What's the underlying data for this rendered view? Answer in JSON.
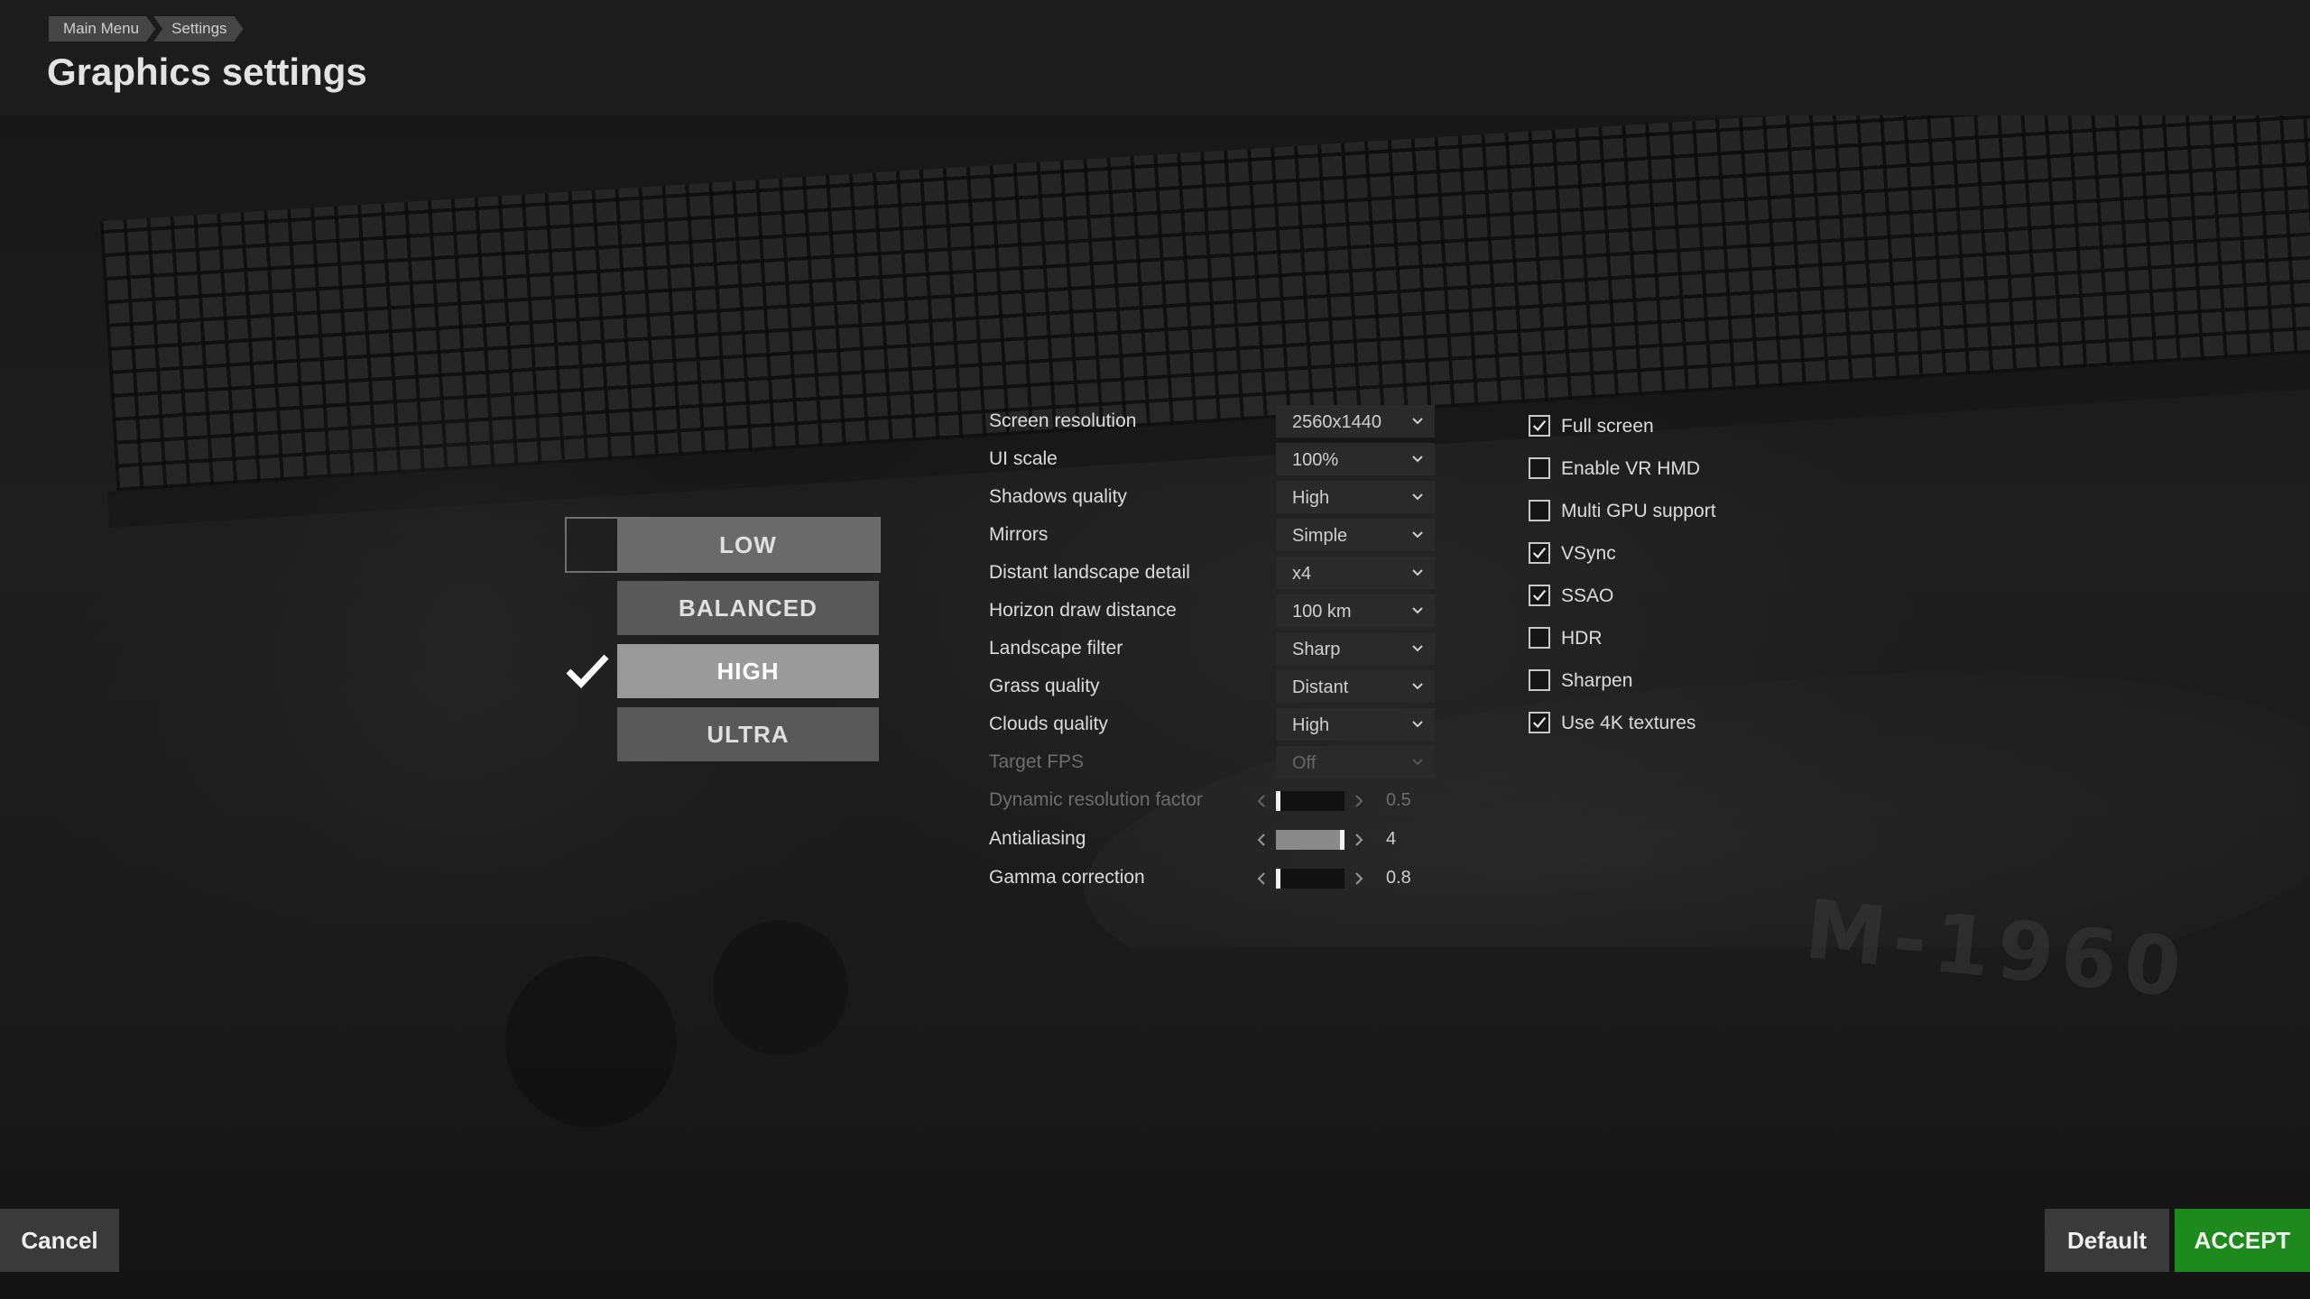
{
  "breadcrumb": [
    "Main Menu",
    "Settings"
  ],
  "page_title": "Graphics settings",
  "presets": [
    {
      "label": "LOW",
      "selected": false,
      "focused": true
    },
    {
      "label": "BALANCED",
      "selected": false,
      "focused": false
    },
    {
      "label": "HIGH",
      "selected": true,
      "focused": false
    },
    {
      "label": "ULTRA",
      "selected": false,
      "focused": false
    }
  ],
  "dropdowns": [
    {
      "label": "Screen resolution",
      "value": "2560x1440",
      "enabled": true
    },
    {
      "label": "UI scale",
      "value": "100%",
      "enabled": true
    },
    {
      "label": "Shadows quality",
      "value": "High",
      "enabled": true
    },
    {
      "label": "Mirrors",
      "value": "Simple",
      "enabled": true
    },
    {
      "label": "Distant landscape detail",
      "value": "x4",
      "enabled": true
    },
    {
      "label": "Horizon draw distance",
      "value": "100 km",
      "enabled": true
    },
    {
      "label": "Landscape filter",
      "value": "Sharp",
      "enabled": true
    },
    {
      "label": "Grass quality",
      "value": "Distant",
      "enabled": true
    },
    {
      "label": "Clouds quality",
      "value": "High",
      "enabled": true
    },
    {
      "label": "Target FPS",
      "value": "Off",
      "enabled": false
    }
  ],
  "sliders": [
    {
      "label": "Dynamic resolution factor",
      "value": "0.5",
      "level": 0.0,
      "enabled": false
    },
    {
      "label": "Antialiasing",
      "value": "4",
      "level": 1.0,
      "enabled": true
    },
    {
      "label": "Gamma correction",
      "value": "0.8",
      "level": 0.0,
      "enabled": true
    }
  ],
  "checkboxes": [
    {
      "label": "Full screen",
      "checked": true
    },
    {
      "label": "Enable VR HMD",
      "checked": false
    },
    {
      "label": "Multi GPU support",
      "checked": false
    },
    {
      "label": "VSync",
      "checked": true
    },
    {
      "label": "SSAO",
      "checked": true
    },
    {
      "label": "HDR",
      "checked": false
    },
    {
      "label": "Sharpen",
      "checked": false
    },
    {
      "label": "Use 4K textures",
      "checked": true
    }
  ],
  "buttons": {
    "cancel": "Cancel",
    "default": "Default",
    "accept": "ACCEPT"
  },
  "background_text": "M-1960",
  "colors": {
    "accept": "#1e8a1e",
    "preset_active": "#9a9a9a",
    "preset": "#595959"
  }
}
